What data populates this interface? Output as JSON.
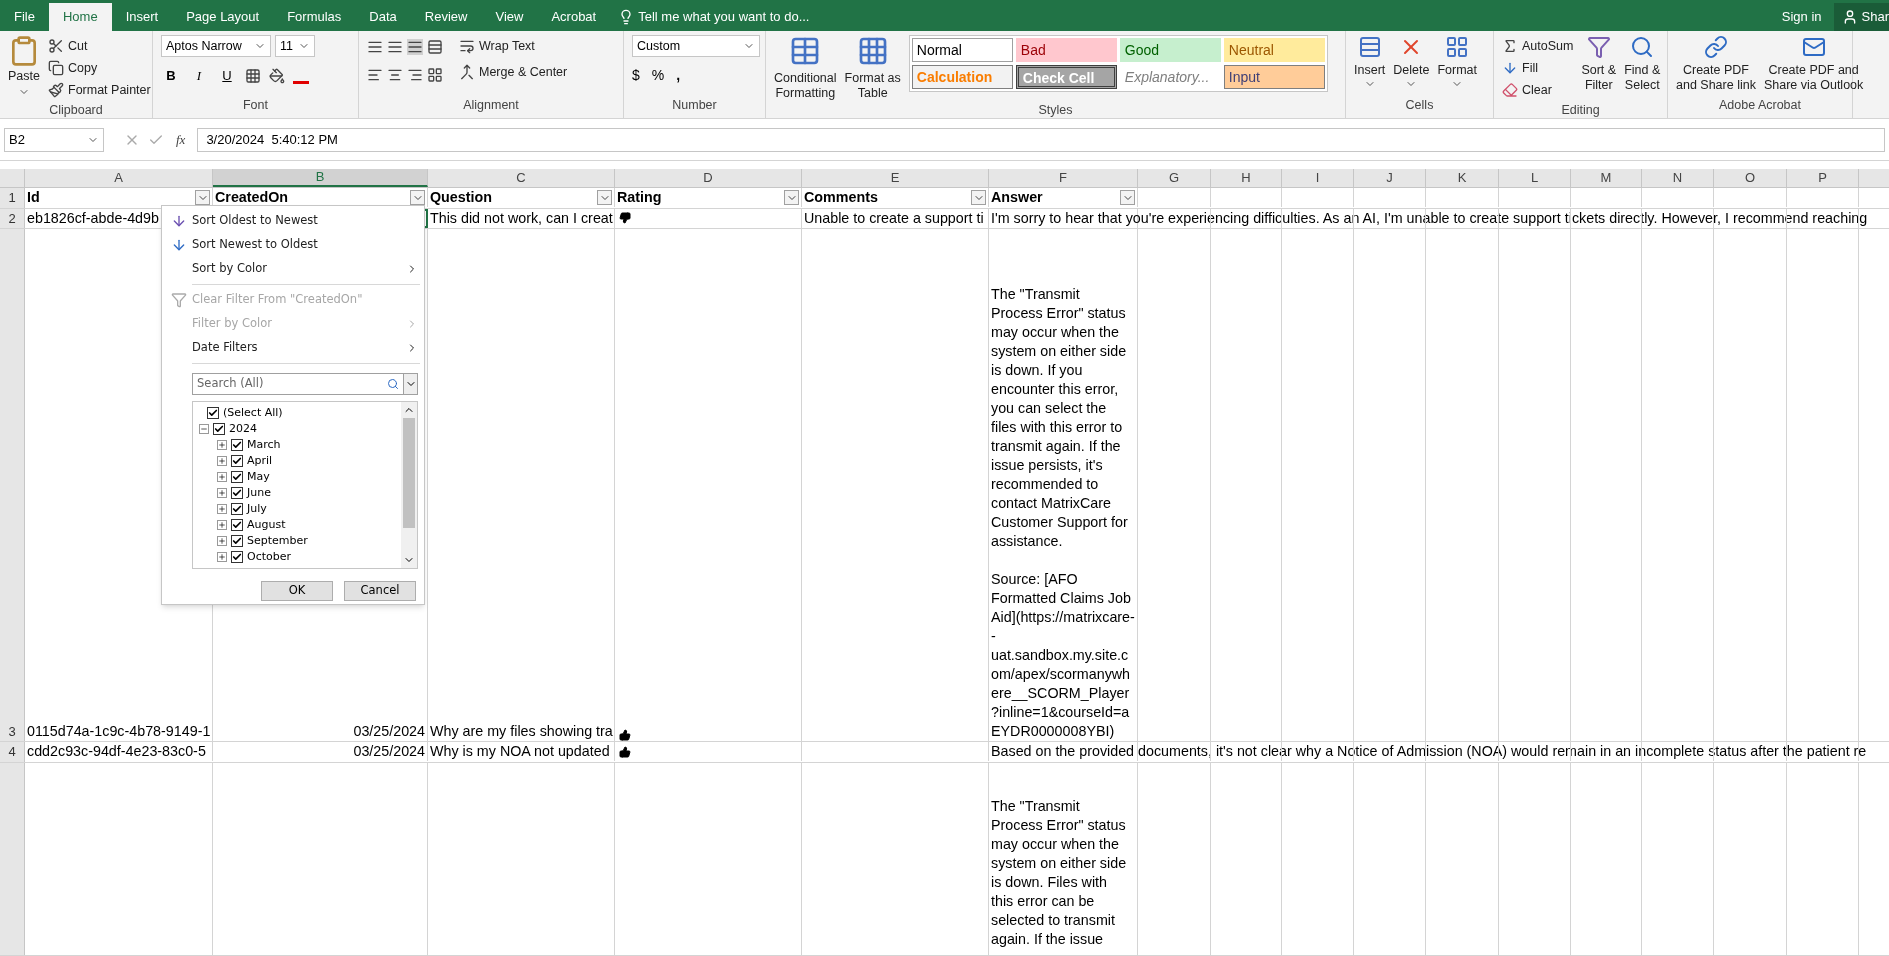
{
  "ribbon_tabs": [
    {
      "label": "File",
      "selected": false
    },
    {
      "label": "Home",
      "selected": true
    },
    {
      "label": "Insert",
      "selected": false
    },
    {
      "label": "Page Layout",
      "selected": false
    },
    {
      "label": "Formulas",
      "selected": false
    },
    {
      "label": "Data",
      "selected": false
    },
    {
      "label": "Review",
      "selected": false
    },
    {
      "label": "View",
      "selected": false
    },
    {
      "label": "Acrobat",
      "selected": false
    }
  ],
  "tell_me": "Tell me what you want to do...",
  "sign_in": "Sign in",
  "share": "Shar",
  "clipboard": {
    "paste": "Paste",
    "cut": "Cut",
    "copy": "Copy",
    "format_painter": "Format Painter",
    "label": "Clipboard"
  },
  "font": {
    "name": "Aptos Narrow",
    "size": "11",
    "bold": "B",
    "italic": "I",
    "underline": "U",
    "label": "Font"
  },
  "alignment": {
    "wrap_text": "Wrap Text",
    "merge_center": "Merge & Center",
    "label": "Alignment"
  },
  "number": {
    "format": "Custom",
    "currency": "$",
    "percent": "%",
    "comma": ",",
    "label": "Number"
  },
  "styles": {
    "conditional_formatting": "Conditional\nFormatting",
    "format_as_table": "Format as\nTable",
    "label": "Styles",
    "cell_styles": [
      {
        "name": "Normal",
        "kind": "normal",
        "color": "#ffffff"
      },
      {
        "name": "Bad",
        "kind": "bad",
        "color": "#ffc7ce"
      },
      {
        "name": "Good",
        "kind": "good",
        "color": "#c6efce"
      },
      {
        "name": "Neutral",
        "kind": "neutral",
        "color": "#ffeb9c"
      },
      {
        "name": "Calculation",
        "kind": "calculation",
        "color": "#f2f2f2"
      },
      {
        "name": "Check Cell",
        "kind": "check_cell",
        "color": "#a5a5a5"
      },
      {
        "name": "Explanatory...",
        "kind": "explanatory",
        "color": "#ffffff"
      },
      {
        "name": "Input",
        "kind": "input",
        "color": "#ffcc99"
      }
    ]
  },
  "cells": {
    "insert": "Insert",
    "delete": "Delete",
    "format": "Format",
    "label": "Cells"
  },
  "editing": {
    "autosum": "AutoSum",
    "fill": "Fill",
    "clear": "Clear",
    "sort_filter": "Sort &\nFilter",
    "find_select": "Find &\nSelect",
    "label": "Editing"
  },
  "acrobat": {
    "share_link": "Create PDF\nand Share link",
    "share_outlook": "Create PDF and\nShare via Outlook",
    "label": "Adobe Acrobat"
  },
  "formula_bar": {
    "name_box": "B2",
    "fx": "fx",
    "formula": "3/20/2024  5:40:12 PM"
  },
  "columns": [
    {
      "letter": "A",
      "selected": false
    },
    {
      "letter": "B",
      "selected": true
    },
    {
      "letter": "C",
      "selected": false
    },
    {
      "letter": "D",
      "selected": false
    },
    {
      "letter": "E",
      "selected": false
    },
    {
      "letter": "F",
      "selected": false
    },
    {
      "letter": "G",
      "selected": false
    },
    {
      "letter": "H",
      "selected": false
    },
    {
      "letter": "I",
      "selected": false
    },
    {
      "letter": "J",
      "selected": false
    },
    {
      "letter": "K",
      "selected": false
    },
    {
      "letter": "L",
      "selected": false
    },
    {
      "letter": "M",
      "selected": false
    },
    {
      "letter": "N",
      "selected": false
    },
    {
      "letter": "O",
      "selected": false
    },
    {
      "letter": "P",
      "selected": false
    }
  ],
  "rows": [
    {
      "number": "1",
      "kind": "header",
      "cells": [
        {
          "text": "Id",
          "selected": false
        },
        {
          "text": "CreatedOn",
          "selected": false
        },
        {
          "text": "Question",
          "selected": false
        },
        {
          "text": "Rating",
          "selected": false
        },
        {
          "text": "Comments",
          "selected": false
        },
        {
          "text": "Answer",
          "selected": false
        }
      ]
    },
    {
      "number": "2",
      "kind": "data",
      "cells": [
        {
          "text": "eb1826cf-abde-4d9b",
          "selected": false
        },
        {
          "selected": true
        },
        {
          "text": "This did not work, can I creat",
          "selected": false
        },
        {
          "kind": "thumbs_down",
          "selected": false
        },
        {
          "text": "Unable to create a support ti",
          "selected": false
        },
        {
          "text": "I'm sorry to hear that you're experiencing difficulties. As an AI, I'm unable to create support tickets directly. However, I recommend reaching",
          "selected": false
        }
      ]
    },
    {
      "number": "3",
      "kind": "data",
      "cells": [
        {
          "text": "0115d74a-1c9c-4b78-9149-1",
          "selected": false
        },
        {
          "text": "03/25/2024",
          "selected": false
        },
        {
          "text": "Why are my files showing tra",
          "selected": false
        },
        {
          "kind": "thumbs_up",
          "selected": false
        },
        {
          "selected": false
        },
        {
          "text": "The \"Transmit\nProcess Error\" status\nmay occur when the\nsystem on either side\nis down. If you\nencounter this error,\nyou can select the\nfiles with this error to\ntransmit again. If the\nissue persists, it's\nrecommended to\ncontact MatrixCare\nCustomer Support for\nassistance.\n\nSource: [AFO\nFormatted Claims Job\nAid](https://matrixcare-\n-\nuat.sandbox.my.site.c\nom/apex/scormanywh\nere__SCORM_Player\n?inline=1&courseId=a\nEYDR0000008YBI)",
          "selected": false
        }
      ]
    },
    {
      "number": "4",
      "kind": "data",
      "cells": [
        {
          "text": "cdd2c93c-94df-4e23-83c0-5",
          "selected": false
        },
        {
          "text": "03/25/2024",
          "selected": false
        },
        {
          "text": "Why is my NOA not updated",
          "selected": false
        },
        {
          "kind": "thumbs_up",
          "selected": false
        },
        {
          "selected": false
        },
        {
          "text": "Based on the provided documents, it's not clear why a Notice of Admission (NOA) would remain in an incomplete status after the patient re",
          "selected": false
        }
      ]
    },
    {
      "kind": "data",
      "cells": [
        {
          "selected": false
        },
        {
          "selected": false
        },
        {
          "selected": false
        },
        {
          "selected": false
        },
        {
          "selected": false
        },
        {
          "text": "The \"Transmit\nProcess Error\" status\nmay occur when the\nsystem on either side\nis down. Files with\nthis error can be\nselected to transmit\nagain. If the issue",
          "selected": false
        }
      ]
    }
  ],
  "filter_menu": {
    "items": [
      {
        "label": "Sort Oldest to Newest",
        "kind": "sort_asc",
        "disabled": false,
        "submenu": false
      },
      {
        "label": "Sort Newest to Oldest",
        "kind": "sort_desc",
        "disabled": false,
        "submenu": false
      },
      {
        "label": "Sort by Color",
        "kind": "plain",
        "disabled": false,
        "submenu": true
      },
      {
        "kind": "separator"
      },
      {
        "label": "Clear Filter From \"CreatedOn\"",
        "kind": "clear_filter",
        "disabled": true,
        "submenu": false
      },
      {
        "label": "Filter by Color",
        "kind": "plain",
        "disabled": true,
        "submenu": true
      },
      {
        "label": "Date Filters",
        "kind": "plain",
        "disabled": false,
        "submenu": true
      }
    ],
    "search_placeholder": "Search (All)",
    "select_all": {
      "label": "(Select All)",
      "checked": true
    },
    "tree": [
      {
        "label": "2024",
        "checked": true,
        "expanded": true,
        "children": [
          {
            "label": "March",
            "checked": true,
            "expanded": false
          },
          {
            "label": "April",
            "checked": true,
            "expanded": false
          },
          {
            "label": "May",
            "checked": true,
            "expanded": false
          },
          {
            "label": "June",
            "checked": true,
            "expanded": false
          },
          {
            "label": "July",
            "checked": true,
            "expanded": false
          },
          {
            "label": "August",
            "checked": true,
            "expanded": false
          },
          {
            "label": "September",
            "checked": true,
            "expanded": false
          },
          {
            "label": "October",
            "checked": true,
            "expanded": false
          }
        ]
      }
    ],
    "ok": "OK",
    "cancel": "Cancel"
  }
}
